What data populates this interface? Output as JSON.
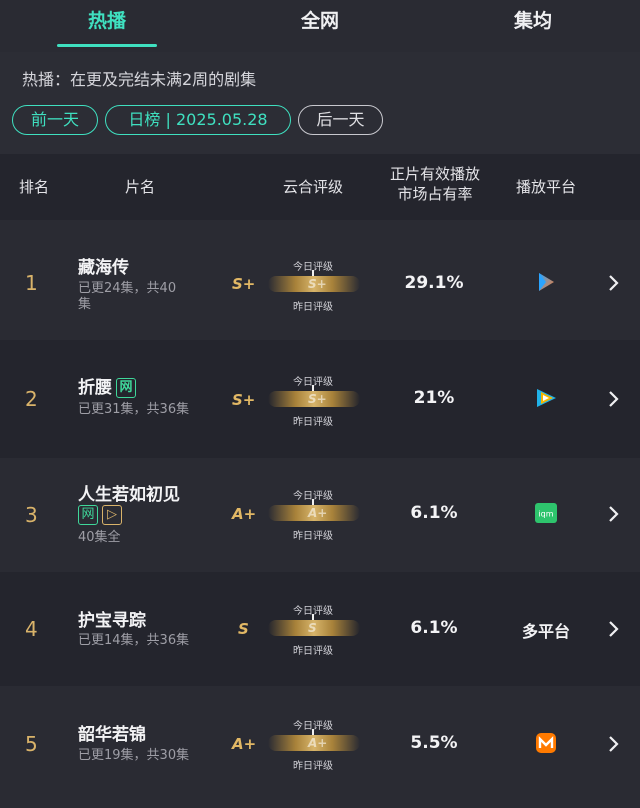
{
  "tabs": [
    {
      "label": "热播"
    },
    {
      "label": "全网"
    },
    {
      "label": "集均"
    }
  ],
  "description": "热播：在更及完结未满2周的剧集",
  "date_nav": {
    "prev": "前一天",
    "current": "日榜 | 2025.05.28",
    "next": "后一天"
  },
  "columns": {
    "rank": "排名",
    "title": "片名",
    "rating": "云合评级",
    "share_line1": "正片有效播放",
    "share_line2": "市场占有率",
    "platform": "播放平台"
  },
  "rating_labels": {
    "today": "今日评级",
    "yesterday": "昨日评级"
  },
  "rows": [
    {
      "rank": "1",
      "title": "藏海传",
      "episodes": "已更24集，共40",
      "episodes2": "集",
      "grade": "S+",
      "share": "29.1%",
      "platform": "优酷",
      "platform_icon": "youku-icon",
      "platform_text": ""
    },
    {
      "rank": "2",
      "title": "折腰",
      "badge": "网",
      "episodes": "已更31集，共36集",
      "grade": "S+",
      "share": "21%",
      "platform": "腾讯视频",
      "platform_icon": "tencent-video-icon",
      "platform_text": ""
    },
    {
      "rank": "3",
      "title": "人生若如初见",
      "badge": "网",
      "badge2": "▷",
      "episodes": "40集全",
      "grade": "A+",
      "share": "6.1%",
      "platform": "爱奇艺",
      "platform_icon": "iqiyi-icon",
      "platform_text": ""
    },
    {
      "rank": "4",
      "title": "护宝寻踪",
      "episodes": "已更14集，共36集",
      "grade": "S",
      "share": "6.1%",
      "platform": "多平台",
      "platform_icon": "",
      "platform_text": "多平台"
    },
    {
      "rank": "5",
      "title": "韶华若锦",
      "episodes": "已更19集，共30集",
      "grade": "A+",
      "share": "5.5%",
      "platform": "芒果TV",
      "platform_icon": "mango-tv-icon",
      "platform_text": ""
    }
  ],
  "colors": {
    "accent": "#3fe0c0",
    "gold": "#d9b36a",
    "background": "#24252d"
  }
}
